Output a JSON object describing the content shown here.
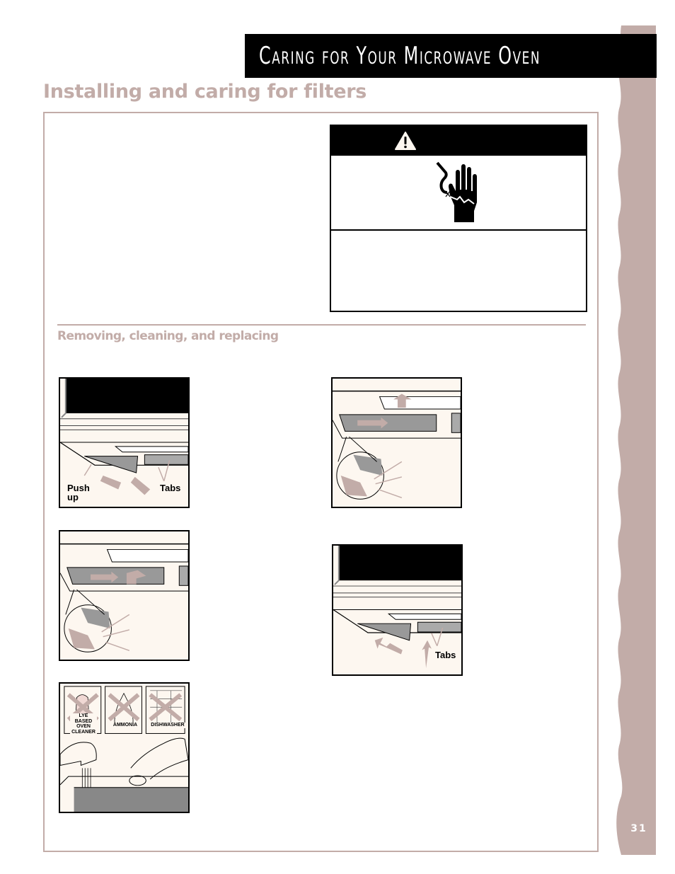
{
  "header": {
    "title": "Caring for Your Microwave Oven"
  },
  "page": {
    "title": "Installing and caring for filters",
    "number": "31"
  },
  "colors": {
    "accent": "#c2aca8",
    "header_bg": "#000000",
    "illustration_bg": "#fdf7f0"
  },
  "warning_box": {
    "header_icon": "warning-triangle-icon",
    "symbol_icon": "electrical-shock-hand-icon"
  },
  "section": {
    "title": "Removing, cleaning, and replacing"
  },
  "illustrations": [
    {
      "id": "remove-filter",
      "icon": "filter-removal-illustration",
      "labels": {
        "push_up": "Push up",
        "tabs": "Tabs"
      }
    },
    {
      "id": "filter-slide-out",
      "icon": "filter-slide-illustration"
    },
    {
      "id": "filter-slot-align",
      "icon": "filter-align-illustration"
    },
    {
      "id": "replace-filter",
      "icon": "filter-replace-illustration",
      "labels": {
        "tabs": "Tabs"
      }
    },
    {
      "id": "clean-filter",
      "icon": "filter-cleaning-illustration",
      "prohibited": [
        {
          "label": "LYE BASED OVEN CLEANER",
          "lines": [
            "LYE",
            "BASED",
            "OVEN",
            "CLEANER"
          ]
        },
        {
          "label": "AMMONIA",
          "lines": [
            "AMMONIA"
          ]
        },
        {
          "label": "DISHWASHER",
          "lines": [
            "DISHWASHER"
          ]
        }
      ]
    }
  ]
}
